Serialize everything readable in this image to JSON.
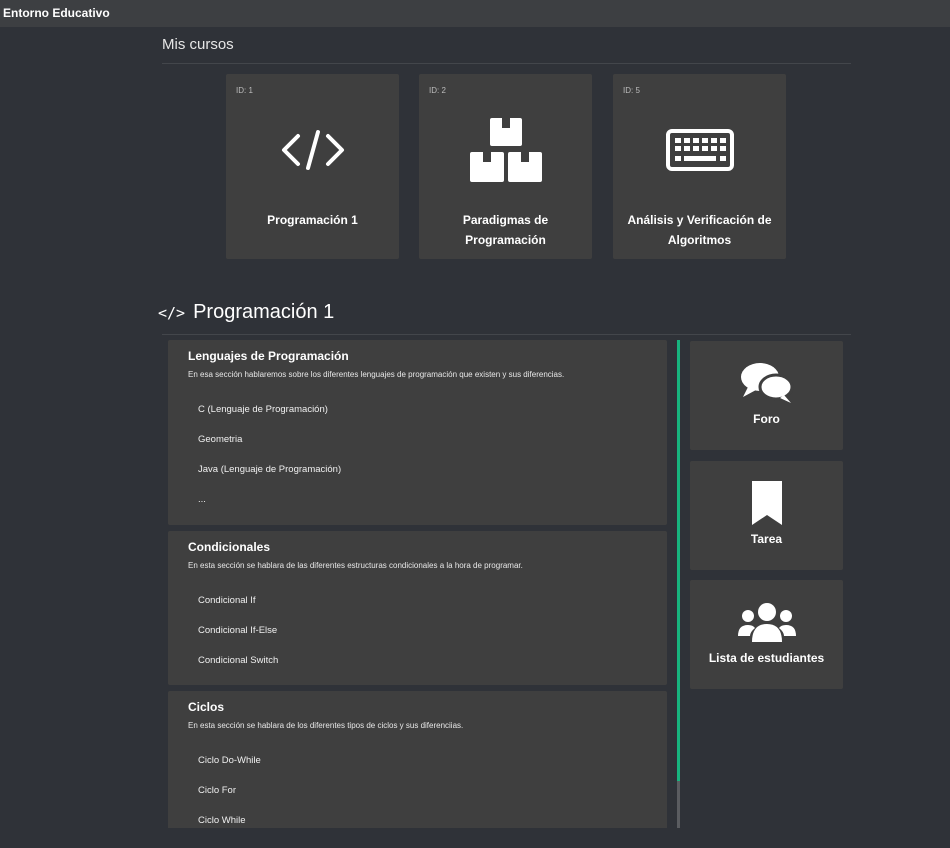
{
  "app": {
    "title": "Entorno Educativo"
  },
  "my_courses": {
    "title": "Mis cursos",
    "cards": [
      {
        "id_label": "ID: 1",
        "name": "Programación 1",
        "icon": "code-icon"
      },
      {
        "id_label": "ID: 2",
        "name": "Paradigmas de Programación",
        "icon": "boxes-icon"
      },
      {
        "id_label": "ID: 5",
        "name": "Análisis y Verificación de Algoritmos",
        "icon": "keyboard-icon"
      }
    ]
  },
  "course": {
    "icon_text": "</>",
    "title": "Programación 1",
    "units": [
      {
        "title": "Lenguajes de Programación",
        "description": "En esa sección hablaremos sobre los diferentes lenguajes de programación que existen y sus diferencias.",
        "items": [
          "C (Lenguaje de Programación)",
          "Geometria",
          "Java (Lenguaje de Programación)",
          "..."
        ]
      },
      {
        "title": "Condicionales",
        "description": "En esta sección se hablara de las diferentes estructuras condicionales a la hora de programar.",
        "items": [
          "Condicional If",
          "Condicional If-Else",
          "Condicional Switch"
        ]
      },
      {
        "title": "Ciclos",
        "description": "En esta sección se hablara de los diferentes tipos de ciclos y sus diferenciias.",
        "items": [
          "Ciclo Do-While",
          "Ciclo For",
          "Ciclo While"
        ]
      }
    ]
  },
  "sidebar": {
    "buttons": [
      {
        "label": "Foro",
        "icon": "comments-icon"
      },
      {
        "label": "Tarea",
        "icon": "bookmark-icon"
      },
      {
        "label": "Lista de estudiantes",
        "icon": "users-icon"
      }
    ]
  },
  "colors": {
    "background": "#2f3238",
    "card": "#3f3f3f",
    "accent": "#17b47f",
    "topbar": "#3d3f42"
  }
}
